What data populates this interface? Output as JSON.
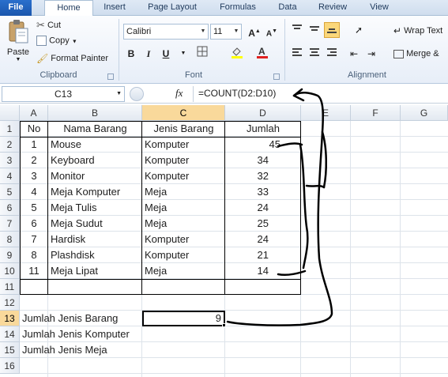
{
  "tabs": [
    "File",
    "Home",
    "Insert",
    "Page Layout",
    "Formulas",
    "Data",
    "Review",
    "View"
  ],
  "ribbon": {
    "clipboard": {
      "paste": "Paste",
      "cut": "Cut",
      "copy": "Copy",
      "format_painter": "Format Painter",
      "label": "Clipboard"
    },
    "font": {
      "name": "Calibri",
      "size": "11",
      "bold": "B",
      "italic": "I",
      "underline": "U",
      "label": "Font"
    },
    "alignment": {
      "wrap": "Wrap Text",
      "merge": "Merge &",
      "label": "Alignment"
    }
  },
  "formula_bar": {
    "name_box": "C13",
    "fx": "fx",
    "formula": "=COUNT(D2:D10)"
  },
  "columns": [
    "A",
    "B",
    "C",
    "D",
    "E",
    "F",
    "G"
  ],
  "rows": [
    "1",
    "2",
    "3",
    "4",
    "5",
    "6",
    "7",
    "8",
    "9",
    "10",
    "11",
    "12",
    "13",
    "14",
    "15",
    "16"
  ],
  "table": {
    "headers": [
      "No",
      "Nama Barang",
      "Jenis Barang",
      "Jumlah"
    ],
    "rows": [
      [
        "1",
        "Mouse",
        "Komputer",
        "45"
      ],
      [
        "2",
        "Keyboard",
        "Komputer",
        "34"
      ],
      [
        "3",
        "Monitor",
        "Komputer",
        "32"
      ],
      [
        "4",
        "Meja Komputer",
        "Meja",
        "33"
      ],
      [
        "5",
        "Meja Tulis",
        "Meja",
        "24"
      ],
      [
        "6",
        "Meja Sudut",
        "Meja",
        "25"
      ],
      [
        "7",
        "Hardisk",
        "Komputer",
        "24"
      ],
      [
        "8",
        "Plashdisk",
        "Komputer",
        "21"
      ],
      [
        "11",
        "Meja Lipat",
        "Meja",
        "14"
      ]
    ]
  },
  "summary": [
    {
      "label": "Jumlah Jenis Barang",
      "value": "9"
    },
    {
      "label": "Jumlah Jenis Komputer",
      "value": ""
    },
    {
      "label": "Jumlah Jenis Meja",
      "value": ""
    }
  ],
  "selected_cell": "C13",
  "colors": {
    "selection": "#f9d99b",
    "file_tab": "#1a56ad",
    "annotation": "#000000"
  }
}
